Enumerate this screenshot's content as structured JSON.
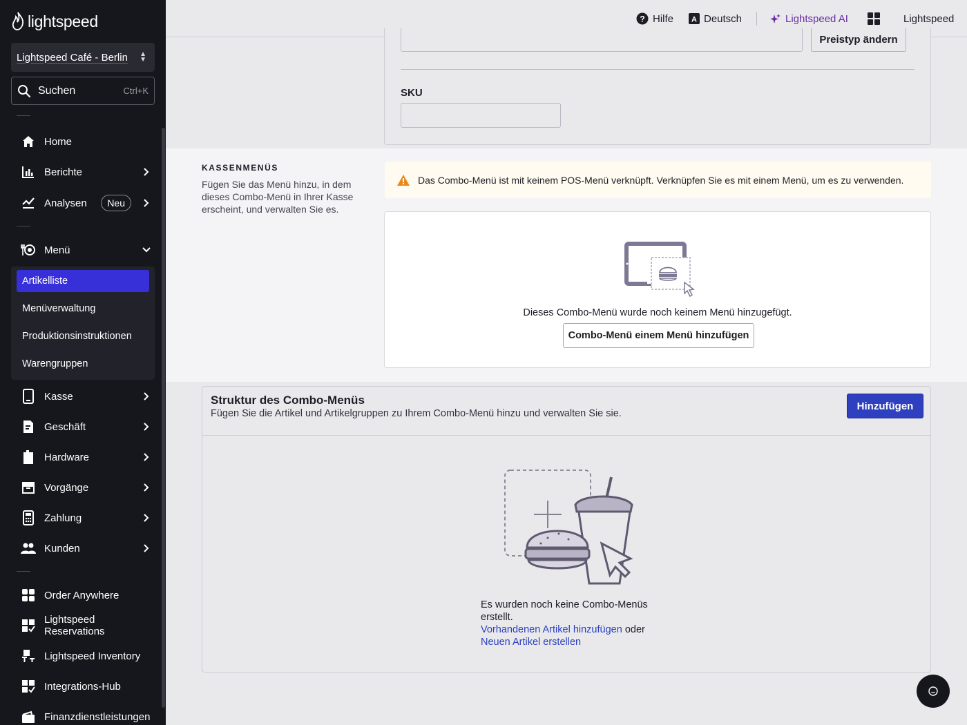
{
  "brand": {
    "name": "lightspeed"
  },
  "store_selector": {
    "value": "Lightspeed Café - Berlin"
  },
  "search": {
    "label": "Suchen",
    "shortcut": "Ctrl+K"
  },
  "nav": {
    "home": "Home",
    "reports": "Berichte",
    "analytics": "Analysen",
    "analytics_badge": "Neu",
    "menu": "Menü",
    "menu_sub": [
      "Artikelliste",
      "Menüverwaltung",
      "Produktionsinstruktionen",
      "Warengruppen"
    ],
    "pos": "Kasse",
    "business": "Geschäft",
    "hardware": "Hardware",
    "operations": "Vorgänge",
    "payment": "Zahlung",
    "customers": "Kunden",
    "order_anywhere": "Order Anywhere",
    "reservations": "Lightspeed Reservations",
    "inventory": "Lightspeed Inventory",
    "integrations": "Integrations-Hub",
    "financial": "Finanzdienstleistungen"
  },
  "header": {
    "help": "Hilfe",
    "language": "Deutsch",
    "ai": "Lightspeed AI",
    "account": "Lightspeed"
  },
  "price_section": {
    "change_price_type": "Preistyp ändern"
  },
  "sku": {
    "label": "SKU",
    "value": ""
  },
  "pos_menus": {
    "title": "KASSENMENÜS",
    "description": "Fügen Sie das Menü hinzu, in dem dieses Combo-Menü in Ihrer Kasse erscheint, und verwalten Sie es.",
    "warning": "Das Combo-Menü ist mit keinem POS-Menü verknüpft. Verknüpfen Sie es mit einem Menü, um es zu verwenden.",
    "empty_text": "Dieses Combo-Menü wurde noch keinem Menü hinzugefügt.",
    "add_button": "Combo-Menü einem Menü hinzufügen"
  },
  "structure": {
    "title": "Struktur des Combo-Menüs",
    "subtitle": "Fügen Sie die Artikel und Artikelgruppen zu Ihrem Combo-Menü hinzu und verwalten Sie sie.",
    "add_button": "Hinzufügen",
    "empty_line1": "Es wurden noch keine Combo-Menüs",
    "empty_line2": "erstellt.",
    "link_existing": "Vorhandenen Artikel hinzufügen",
    "or": "oder",
    "link_new": "Neuen Artikel erstellen"
  },
  "colors": {
    "sidebar_bg": "#16161d",
    "active_item": "#3730d9",
    "primary_button": "#2e3fbf",
    "link": "#2a3fbf",
    "ai": "#6a2aa6",
    "warning_icon": "#e8891e"
  }
}
